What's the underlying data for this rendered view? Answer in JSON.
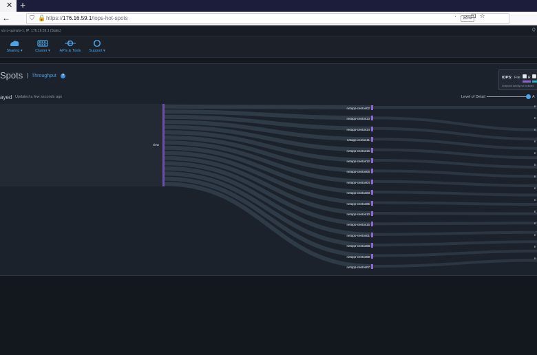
{
  "browser": {
    "tab_close_glyph": "✕",
    "new_tab_glyph": "+",
    "url_scheme": "https://",
    "url_host": "176.16.59.1",
    "url_path": "/iops-hot-spots",
    "zoom": "80%"
  },
  "app": {
    "cluster_info": "vis o-qumulo-1, IP: 176.16.59.1 (Static)",
    "user_initial": "Q",
    "nav": [
      {
        "label": "Sharing ▾",
        "icon": "sharing-icon"
      },
      {
        "label": "Cluster ▾",
        "icon": "cluster-icon"
      },
      {
        "label": "APIs & Tools",
        "icon": "api-icon"
      },
      {
        "label": "Support ▾",
        "icon": "support-icon"
      }
    ],
    "accent_color": "#4ca3e6"
  },
  "page": {
    "title": "Spots",
    "throughput_link": "Throughput",
    "help_glyph": "?",
    "status_title": "ayed",
    "updated": "Updated a few seconds ago",
    "level_of_detail_label": "Level of Detail",
    "level_of_detail_value": "A"
  },
  "legend": {
    "iops_label": "IOPS:",
    "file_label": "File",
    "check_r_label": "R",
    "note": "Snapshot activity not included",
    "read_color": "#8f66cf",
    "write_color": "#2ab3c9"
  },
  "sankey": {
    "source_label": "view",
    "link_color": "#2f3a47",
    "node_color": "#8f66cf",
    "nodes": [
      "netapp-centos02",
      "netapp-centos13",
      "netapp-centos14",
      "netapp-centos11",
      "netapp-centos16",
      "netapp-centos12",
      "netapp-centos06",
      "netapp-centos04",
      "netapp-centos03",
      "netapp-centos05",
      "netapp-centos10",
      "netapp-centos15",
      "netapp-centos01",
      "netapp-centos08",
      "netapp-centos09",
      "netapp-centos07"
    ],
    "right_labels": [
      "n",
      "n",
      "n",
      "n",
      "n",
      "n",
      "n",
      "n",
      "n",
      "n",
      "n",
      "n",
      "n",
      "n"
    ]
  }
}
